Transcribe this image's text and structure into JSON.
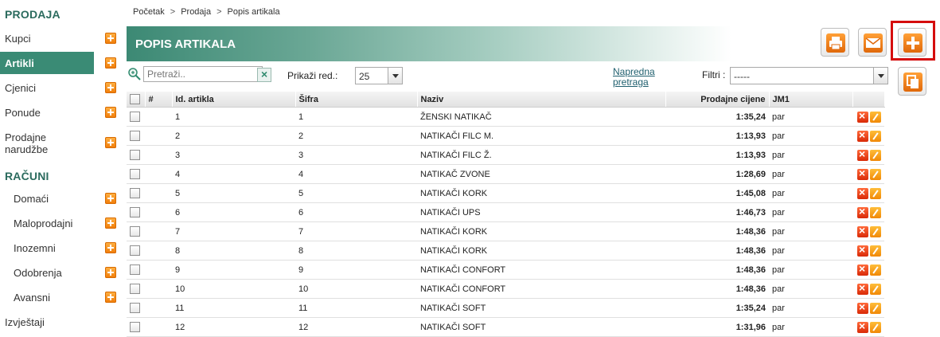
{
  "sidebar": {
    "prodaja_heading": "PRODAJA",
    "racuni_heading": "RAČUNI",
    "items": [
      {
        "label": "Kupci"
      },
      {
        "label": "Artikli"
      },
      {
        "label": "Cjenici"
      },
      {
        "label": "Ponude"
      },
      {
        "label": "Prodajne narudžbe"
      },
      {
        "label": "Domaći"
      },
      {
        "label": "Maloprodajni"
      },
      {
        "label": "Inozemni"
      },
      {
        "label": "Odobrenja"
      },
      {
        "label": "Avansni"
      },
      {
        "label": "Izvještaji"
      }
    ]
  },
  "breadcrumb": {
    "home": "Početak",
    "section": "Prodaja",
    "page": "Popis artikala",
    "sep": ">"
  },
  "page_title": "POPIS ARTIKALA",
  "toolbar": {
    "search_placeholder": "Pretraži..",
    "show_label": "Prikaži red.:",
    "show_value": "25",
    "advanced_search": "Napredna pretraga",
    "filter_label": "Filtri :",
    "filter_value": "-----"
  },
  "table": {
    "headers": {
      "hash": "#",
      "id": "Id. artikla",
      "code": "Šifra",
      "name": "Naziv",
      "price": "Prodajne cijene",
      "unit": "JM1"
    },
    "rows": [
      {
        "id": "1",
        "code": "1",
        "name": "ŽENSKI NATIKAČ",
        "price": "1:35,24",
        "unit": "par"
      },
      {
        "id": "2",
        "code": "2",
        "name": "NATIKAČI FILC M.",
        "price": "1:13,93",
        "unit": "par"
      },
      {
        "id": "3",
        "code": "3",
        "name": "NATIKAČI FILC Ž.",
        "price": "1:13,93",
        "unit": "par"
      },
      {
        "id": "4",
        "code": "4",
        "name": "NATIKAČ ZVONE",
        "price": "1:28,69",
        "unit": "par"
      },
      {
        "id": "5",
        "code": "5",
        "name": "NATIKAČI KORK",
        "price": "1:45,08",
        "unit": "par"
      },
      {
        "id": "6",
        "code": "6",
        "name": "NATIKAČI UPS",
        "price": "1:46,73",
        "unit": "par"
      },
      {
        "id": "7",
        "code": "7",
        "name": "NATIKAČI KORK",
        "price": "1:48,36",
        "unit": "par"
      },
      {
        "id": "8",
        "code": "8",
        "name": "NATIKAČI KORK",
        "price": "1:48,36",
        "unit": "par"
      },
      {
        "id": "9",
        "code": "9",
        "name": "NATIKAČI CONFORT",
        "price": "1:48,36",
        "unit": "par"
      },
      {
        "id": "10",
        "code": "10",
        "name": "NATIKAČI CONFORT",
        "price": "1:48,36",
        "unit": "par"
      },
      {
        "id": "11",
        "code": "11",
        "name": "NATIKAČI SOFT",
        "price": "1:35,24",
        "unit": "par"
      },
      {
        "id": "12",
        "code": "12",
        "name": "NATIKAČI SOFT",
        "price": "1:31,96",
        "unit": "par"
      }
    ]
  },
  "icons": {
    "print": "printer-icon",
    "mail": "envelope-icon",
    "add": "plus-icon",
    "copy": "copy-icon",
    "delete": "delete-icon",
    "edit": "pencil-icon"
  },
  "colors": {
    "brand": "#3a8b75",
    "accent": "#f07b06",
    "highlight": "#d50d0d"
  }
}
